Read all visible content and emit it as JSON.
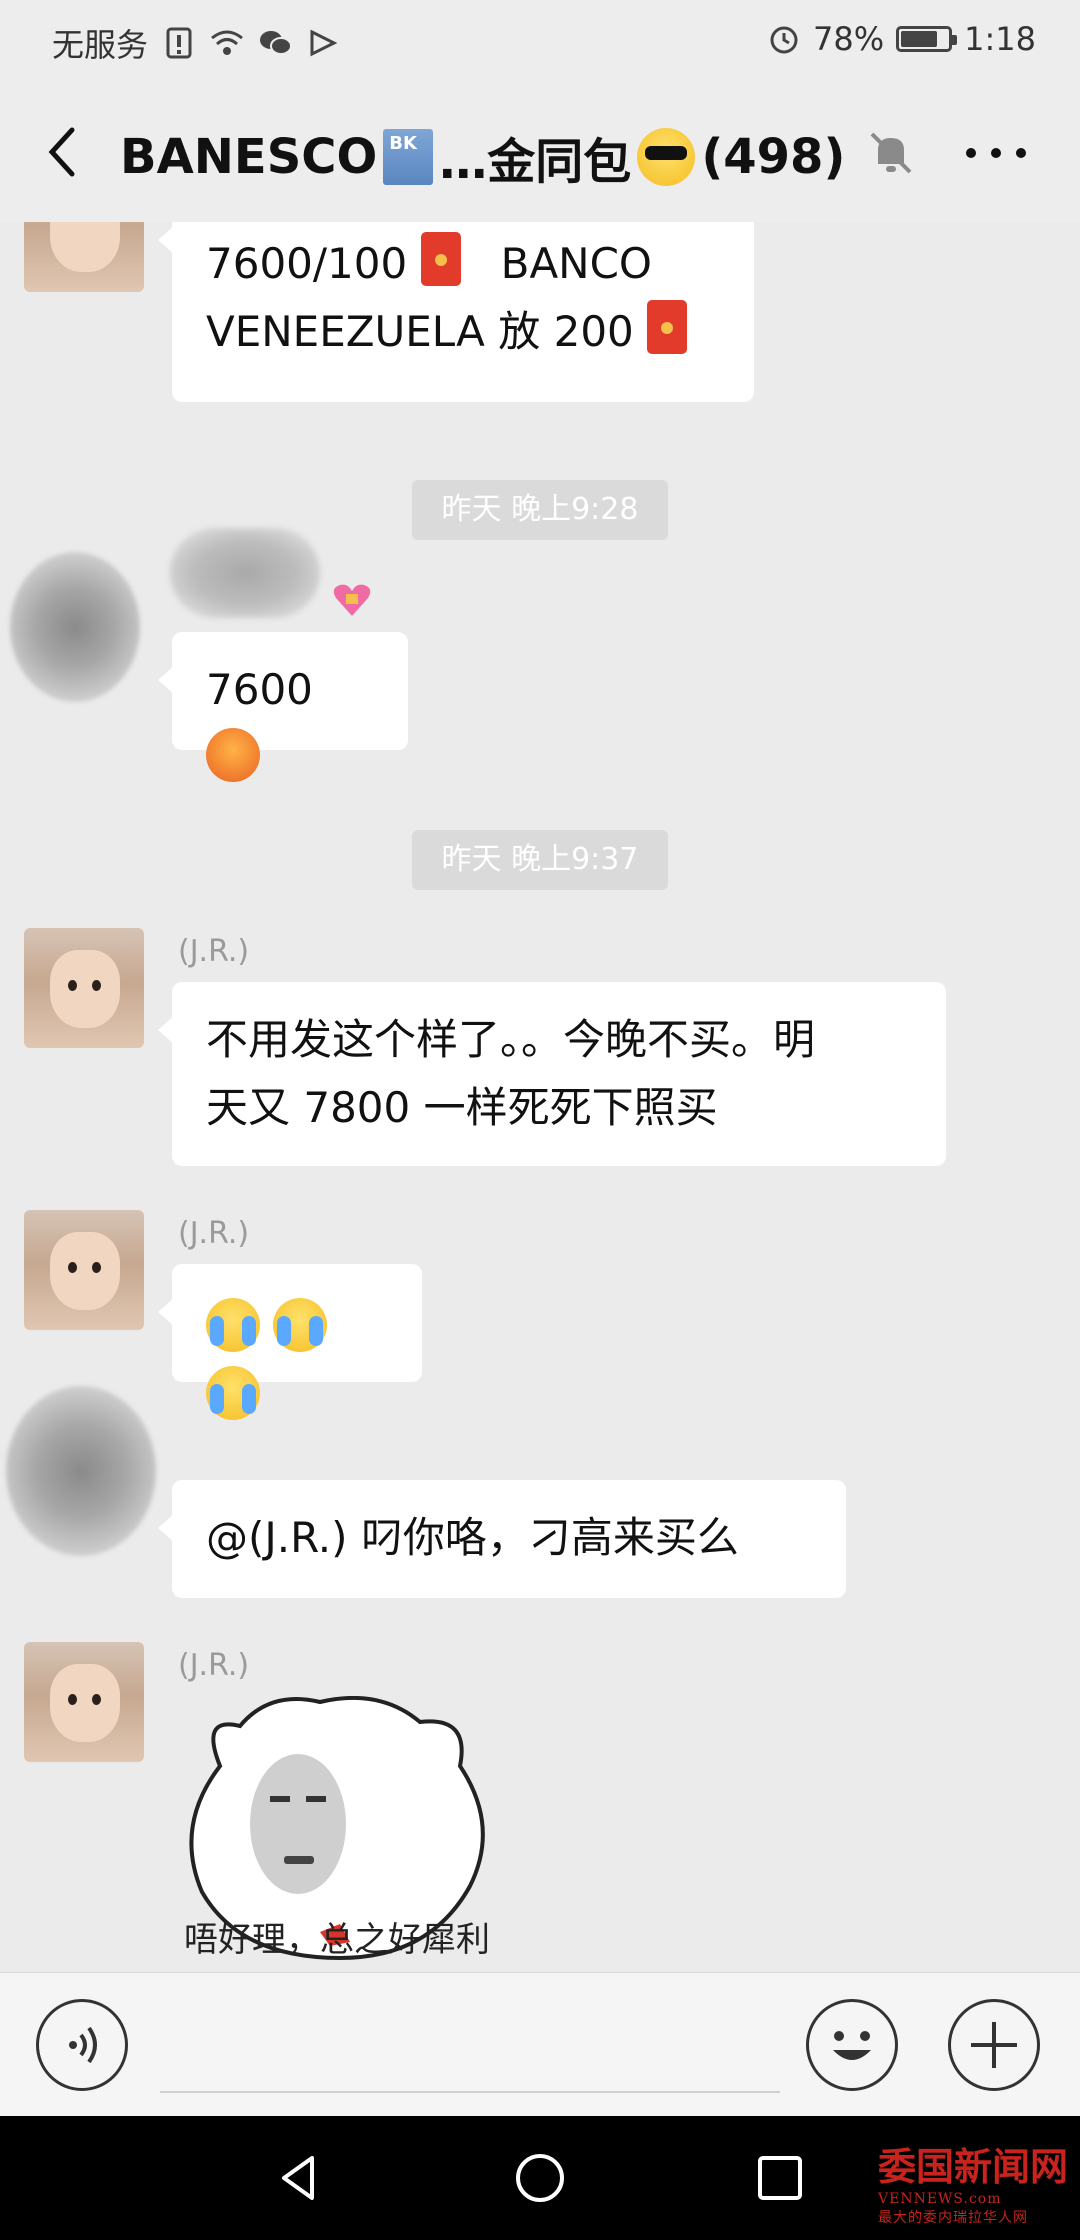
{
  "status_bar": {
    "carrier": "无服务",
    "battery_percent": "78%",
    "battery_level": 0.78,
    "time": "1:18"
  },
  "header": {
    "title_prefix": "BANESCO",
    "title_middle": "…金同包",
    "member_count": "(498)"
  },
  "messages": {
    "m1": {
      "line1_a": "7600/100",
      "line1_b": "BANCO",
      "line2_a": "VENEEZUELA 放  200"
    },
    "ts1": "昨天 晚上9:28",
    "m2": {
      "text": "7600"
    },
    "ts2": "昨天 晚上9:37",
    "m3": {
      "sender": "(J.R.)",
      "line1": "不用发这个样了。。今晚不买。明",
      "line2": "天又 7800 一样死死下照买"
    },
    "m4": {
      "sender": "(J.R.)"
    },
    "m5": {
      "text": "@(J.R.)  叼你咯，刁高来买么"
    },
    "m6": {
      "sender": "(J.R.)",
      "sticker_caption": "唔好理，总之好犀利"
    }
  },
  "watermark": {
    "brand": "委国新闻网",
    "url": "VENNEWS.com",
    "tagline": "最大的委内瑞拉华人网"
  },
  "colors": {
    "accent_red": "#e23b2c",
    "bubble": "#ffffff",
    "background": "#ebebeb"
  }
}
